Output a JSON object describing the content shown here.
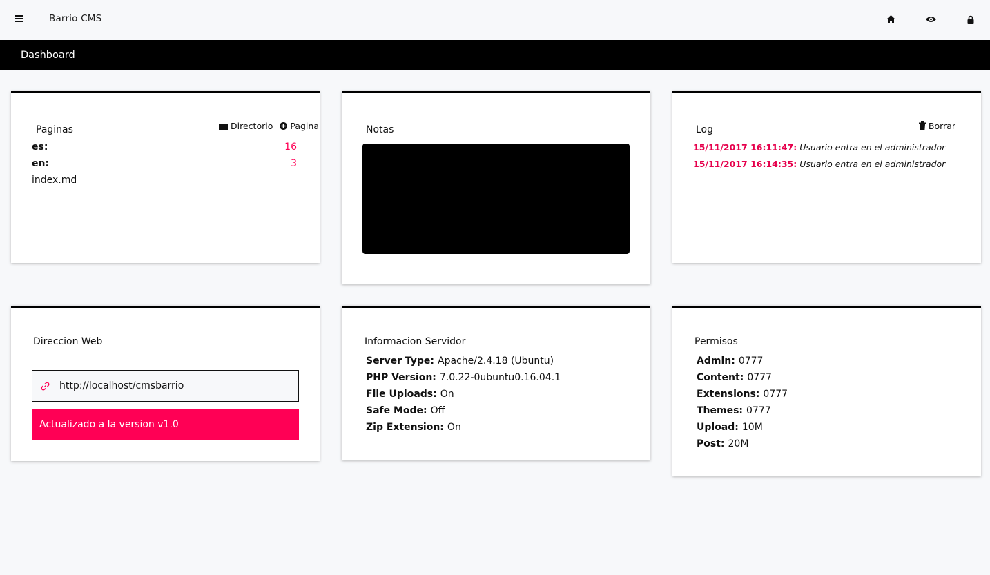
{
  "app": {
    "brand": "Barrio CMS",
    "section": "Dashboard"
  },
  "topbar": {
    "icons": [
      "menu-icon",
      "home-icon",
      "eye-icon",
      "lock-icon"
    ]
  },
  "pages": {
    "title": "Paginas",
    "actions": {
      "directory": "Directorio",
      "page": "Pagina"
    },
    "items": [
      {
        "label": "es:",
        "count": "16"
      },
      {
        "label": "en:",
        "count": "3"
      },
      {
        "label": "index.md",
        "count": ""
      }
    ]
  },
  "notes": {
    "title": "Notas",
    "content": ""
  },
  "log": {
    "title": "Log",
    "clear": "Borrar",
    "entries": [
      {
        "time": "15/11/2017 16:11:47:",
        "message": "Usuario entra en el administrador"
      },
      {
        "time": "15/11/2017 16:14:35:",
        "message": "Usuario entra en el administrador"
      }
    ]
  },
  "web": {
    "title": "Direccion Web",
    "url": "http://localhost/cmsbarrio",
    "update": "Actualizado a la version v1.0"
  },
  "server": {
    "title": "Informacion Servidor",
    "items": [
      {
        "key": "Server Type:",
        "value": "Apache/2.4.18 (Ubuntu)"
      },
      {
        "key": "PHP Version:",
        "value": "7.0.22-0ubuntu0.16.04.1"
      },
      {
        "key": "File Uploads:",
        "value": "On"
      },
      {
        "key": "Safe Mode:",
        "value": "Off"
      },
      {
        "key": "Zip Extension:",
        "value": "On"
      }
    ]
  },
  "permissions": {
    "title": "Permisos",
    "items": [
      {
        "key": "Admin:",
        "value": "0777"
      },
      {
        "key": "Content:",
        "value": "0777"
      },
      {
        "key": "Extensions:",
        "value": "0777"
      },
      {
        "key": "Themes:",
        "value": "0777"
      },
      {
        "key": "Upload:",
        "value": "10M"
      },
      {
        "key": "Post:",
        "value": "20M"
      }
    ]
  },
  "colors": {
    "accent": "#ff0055",
    "header": "#000000",
    "background": "#f7f8fa"
  }
}
